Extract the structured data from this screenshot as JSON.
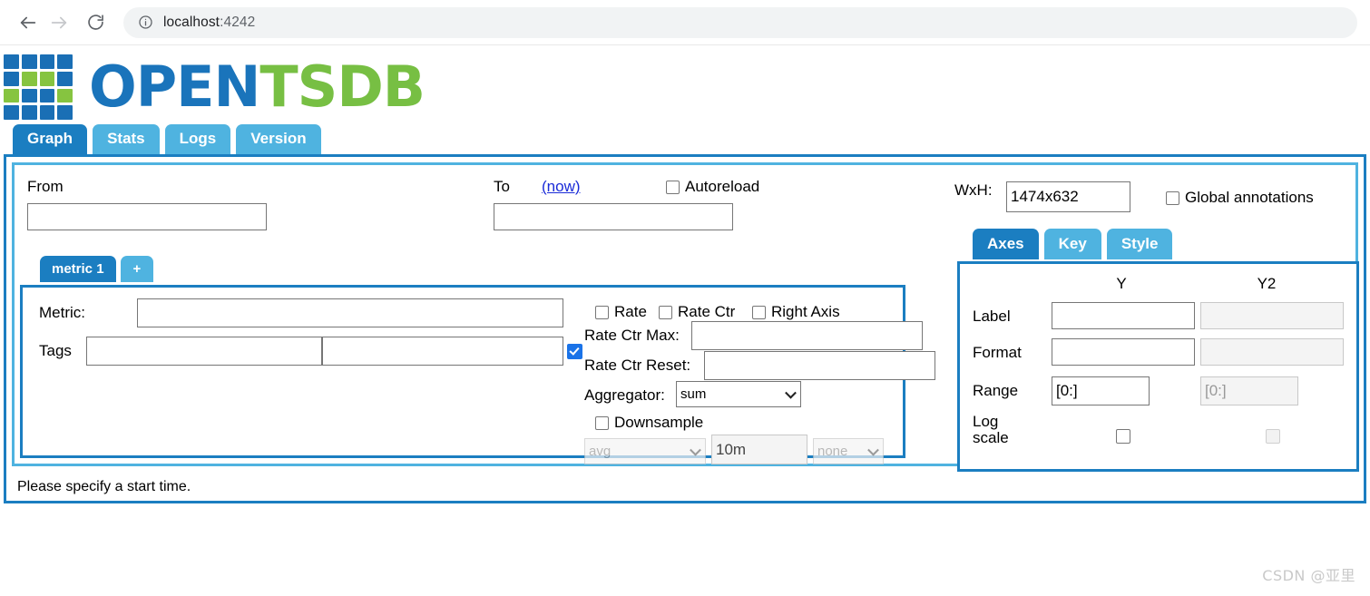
{
  "browser": {
    "back_icon": "arrow-left-icon",
    "forward_icon": "arrow-right-icon",
    "reload_icon": "reload-icon",
    "info_icon": "info-circle-icon",
    "url_host": "localhost",
    "url_port": ":4242"
  },
  "logo": {
    "word_open": "OPEN",
    "word_tsdb": "TSDB",
    "color_blue": "#1a74bb",
    "color_green": "#77bf43"
  },
  "tabs": [
    {
      "label": "Graph",
      "active": true
    },
    {
      "label": "Stats",
      "active": false
    },
    {
      "label": "Logs",
      "active": false
    },
    {
      "label": "Version",
      "active": false
    }
  ],
  "form": {
    "from_label": "From",
    "from_value": "",
    "to_label": "To",
    "to_value": "",
    "now_link": "(now)",
    "autoreload_label": "Autoreload",
    "autoreload_checked": false,
    "wxh_label": "WxH:",
    "wxh_value": "1474x632",
    "global_annotations_label": "Global annotations",
    "global_annotations_checked": false
  },
  "metric_tabs": [
    {
      "label": "metric 1",
      "active": true
    },
    {
      "label": "+",
      "active": false
    }
  ],
  "metric": {
    "metric_label": "Metric:",
    "metric_value": "",
    "tags_label": "Tags",
    "tag_key_value": "",
    "tag_value_value": "",
    "tag_checkbox_checked": true,
    "rate_label": "Rate",
    "rate_checked": false,
    "rate_ctr_label": "Rate Ctr",
    "rate_ctr_checked": false,
    "right_axis_label": "Right Axis",
    "right_axis_checked": false,
    "rate_ctr_max_label": "Rate Ctr Max:",
    "rate_ctr_max_value": "",
    "rate_ctr_reset_label": "Rate Ctr Reset:",
    "rate_ctr_reset_value": "",
    "aggregator_label": "Aggregator:",
    "aggregator_value": "sum",
    "downsample_label": "Downsample",
    "downsample_checked": false,
    "downsample_fn": "avg",
    "downsample_interval": "10m",
    "downsample_fill": "none"
  },
  "right_tabs": [
    {
      "label": "Axes",
      "active": true
    },
    {
      "label": "Key",
      "active": false
    },
    {
      "label": "Style",
      "active": false
    }
  ],
  "axes": {
    "col_y": "Y",
    "col_y2": "Y2",
    "row_label": "Label",
    "row_format": "Format",
    "row_range": "Range",
    "row_logscale": "Log\nscale",
    "row_logscale_line1": "Log",
    "row_logscale_line2": "scale",
    "y_label_value": "",
    "y2_label_value": "",
    "y_format_value": "",
    "y2_format_value": "",
    "y_range_value": "[0:]",
    "y2_range_value": "[0:]",
    "y_logscale_checked": false,
    "y2_logscale_checked": false
  },
  "status_message": "Please specify a start time.",
  "watermark": "CSDN @亚里",
  "colors": {
    "tab_active": "#1b7ec1",
    "tab_inactive": "#4fb3e0",
    "link": "#1a2bd8",
    "checkbox_checked": "#1a73e8"
  }
}
